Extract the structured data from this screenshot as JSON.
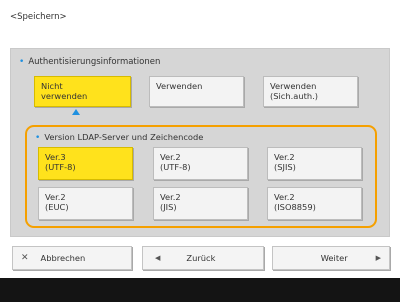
{
  "screen_title": "<Speichern>",
  "auth": {
    "label": "Authentisierungsinformationen",
    "options": [
      {
        "line1": "Nicht",
        "line2": "verwenden",
        "selected": true
      },
      {
        "line1": "Verwenden",
        "line2": "",
        "selected": false
      },
      {
        "line1": "Verwenden",
        "line2": "(Sich.auth.)",
        "selected": false
      }
    ]
  },
  "ldap": {
    "label": "Version LDAP-Server und Zeichencode",
    "options": [
      {
        "line1": "Ver.3",
        "line2": "(UTF-8)",
        "selected": true
      },
      {
        "line1": "Ver.2",
        "line2": "(UTF-8)",
        "selected": false
      },
      {
        "line1": "Ver.2",
        "line2": "(SJIS)",
        "selected": false
      },
      {
        "line1": "Ver.2",
        "line2": "(EUC)",
        "selected": false
      },
      {
        "line1": "Ver.2",
        "line2": "(JIS)",
        "selected": false
      },
      {
        "line1": "Ver.2",
        "line2": "(ISO8859)",
        "selected": false
      }
    ]
  },
  "buttons": {
    "cancel": "Abbrechen",
    "back": "Zurück",
    "next": "Weiter"
  },
  "icons": {
    "cancel": "close-icon",
    "back": "arrow-left-icon",
    "next": "arrow-right-icon"
  },
  "colors": {
    "selected": "#ffe21c",
    "accent": "#1e90e0",
    "highlight_border": "#f5a000"
  }
}
